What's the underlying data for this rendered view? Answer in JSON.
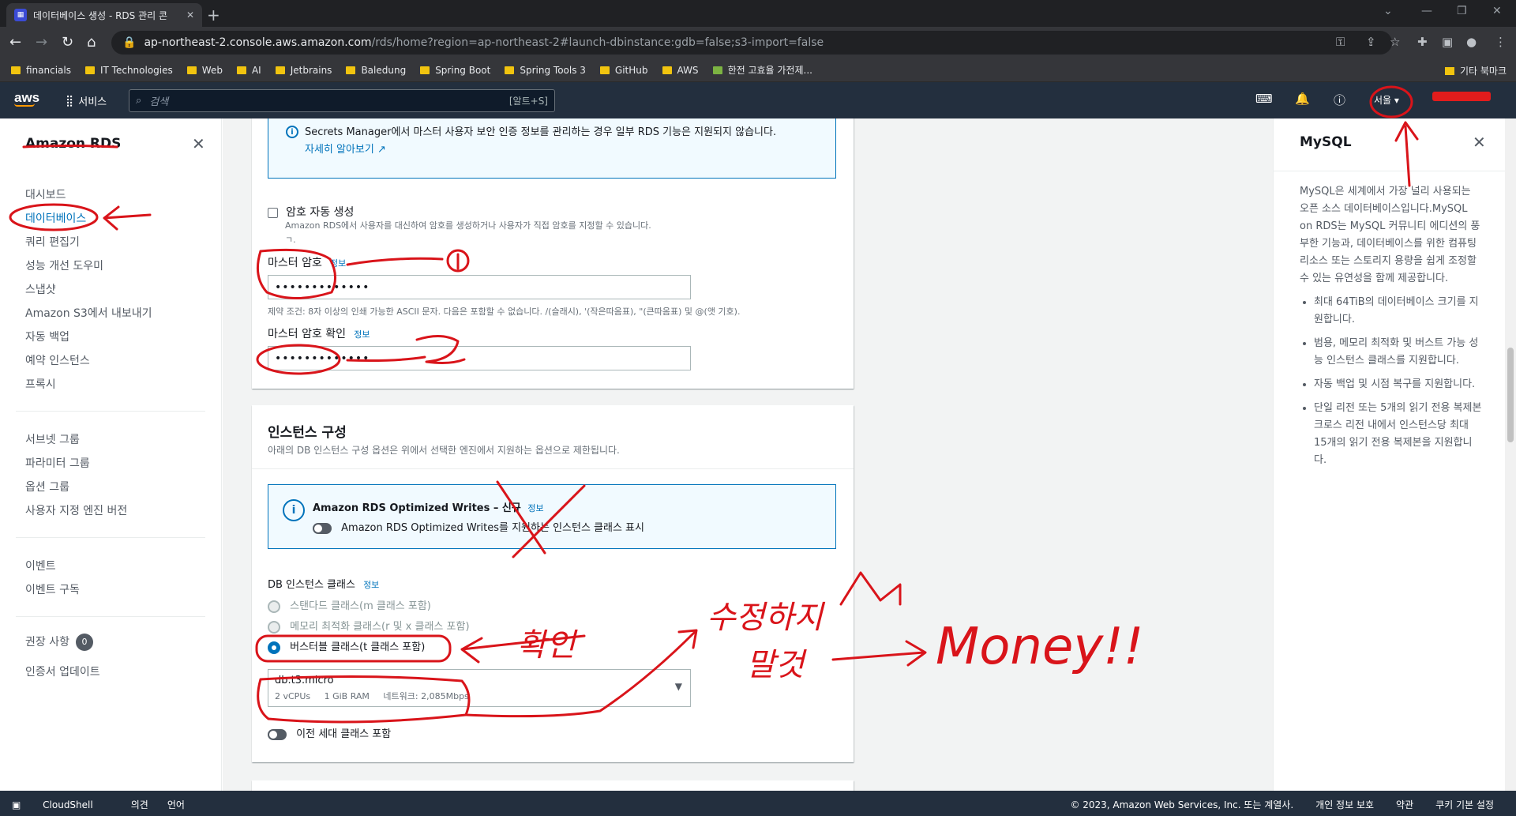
{
  "browser": {
    "tab_title": "데이터베이스 생성 - RDS 관리 콘",
    "tab_close": "✕",
    "new_tab": "+",
    "url_host": "ap-northeast-2.console.aws.amazon.com",
    "url_path": "/rds/home?region=ap-northeast-2#launch-dbinstance:gdb=false;s3-import=false",
    "bookmarks": [
      "financials",
      "IT Technologies",
      "Web",
      "AI",
      "Jetbrains",
      "Baledung",
      "Spring Boot",
      "Spring Tools 3",
      "GitHub",
      "AWS",
      "한전 고효율 가전제..."
    ],
    "other_bookmarks": "기타 북마크"
  },
  "aws_nav": {
    "logo": "aws",
    "services": "서비스",
    "search_placeholder": "검색",
    "search_shortcut": "[알트+S]",
    "region": "서울 ▾"
  },
  "sidebar": {
    "title": "Amazon RDS",
    "group1": [
      "대시보드",
      "데이터베이스",
      "쿼리 편집기",
      "성능 개선 도우미",
      "스냅샷",
      "Amazon S3에서 내보내기",
      "자동 백업",
      "예약 인스턴스",
      "프록시"
    ],
    "group2": [
      "서브넷 그룹",
      "파라미터 그룹",
      "옵션 그룹",
      "사용자 지정 엔진 버전"
    ],
    "group3": [
      "이벤트",
      "이벤트 구독"
    ],
    "recommendations": "권장 사항",
    "recommendations_count": "0",
    "cert_update": "인증서 업데이트"
  },
  "credentials": {
    "secrets_notice": "Secrets Manager에서 마스터 사용자 보안 인증 정보를 관리하는 경우 일부 RDS 기능은 지원되지 않습니다.",
    "learn_more": "자세히 알아보기",
    "auto_password_label": "암호 자동 생성",
    "auto_password_hint": "Amazon RDS에서 사용자를 대신하여 암호를 생성하거나 사용자가 직접 암호를 지정할 수 있습니다.",
    "master_password_label": "마스터 암호",
    "info": "정보",
    "master_password_value": "•••••••••••••",
    "password_constraint": "제약 조건: 8자 이상의 인쇄 가능한 ASCII 문자. 다음은 포함할 수 없습니다. /(슬래시), '(작은따옴표), \"(큰따옴표) 및 @(앳 기호).",
    "confirm_password_label": "마스터 암호 확인",
    "confirm_password_value": "•••••••••••••"
  },
  "instance_config": {
    "title": "인스턴스 구성",
    "subtitle": "아래의 DB 인스턴스 구성 옵션은 위에서 선택한 엔진에서 지원하는 옵션으로 제한됩니다.",
    "optimized_title": "Amazon RDS Optimized Writes – 신규",
    "optimized_toggle_label": "Amazon RDS Optimized Writes를 지원하는 인스턴스 클래스 표시",
    "class_label": "DB 인스턴스 클래스",
    "options": [
      "스탠다드 클래스(m 클래스 포함)",
      "메모리 최적화 클래스(r 및 x 클래스 포함)",
      "버스터블 클래스(t 클래스 포함)"
    ],
    "selected_option_index": 2,
    "instance_name": "db.t3.micro",
    "instance_specs": [
      "2 vCPUs",
      "1 GiB RAM",
      "네트워크: 2,085Mbps"
    ],
    "previous_gen_label": "이전 세대 클래스 포함"
  },
  "help_panel": {
    "title": "MySQL",
    "intro": "MySQL은 세계에서 가장 널리 사용되는 오픈 소스 데이터베이스입니다.MySQL on RDS는 MySQL 커뮤니티 에디션의 풍부한 기능과, 데이터베이스를 위한 컴퓨팅 리소스 또는 스토리지 용량을 쉽게 조정할 수 있는 유연성을 함께 제공합니다.",
    "bullets": [
      "최대 64TiB의 데이터베이스 크기를 지원합니다.",
      "범용, 메모리 최적화 및 버스트 가능 성능 인스턴스 클래스를 지원합니다.",
      "자동 백업 및 시점 복구를 지원합니다.",
      "단일 리전 또는 5개의 읽기 전용 복제본 크로스 리전 내에서 인스턴스당 최대 15개의 읽기 전용 복제본을 지원합니다."
    ]
  },
  "footer": {
    "cloudshell": "CloudShell",
    "feedback": "의견",
    "language": "언어",
    "copyright": "© 2023, Amazon Web Services, Inc. 또는 계열사.",
    "privacy": "개인 정보 보호",
    "terms": "약관",
    "cookies": "쿠키 기본 설정"
  },
  "annotations": {
    "label_one": "①",
    "label_two": "②",
    "label_check": "확인",
    "label_dont_change": "수정하지",
    "label_dont_change_2": "말것",
    "label_money": "Money!!",
    "color": "#d9141a"
  }
}
